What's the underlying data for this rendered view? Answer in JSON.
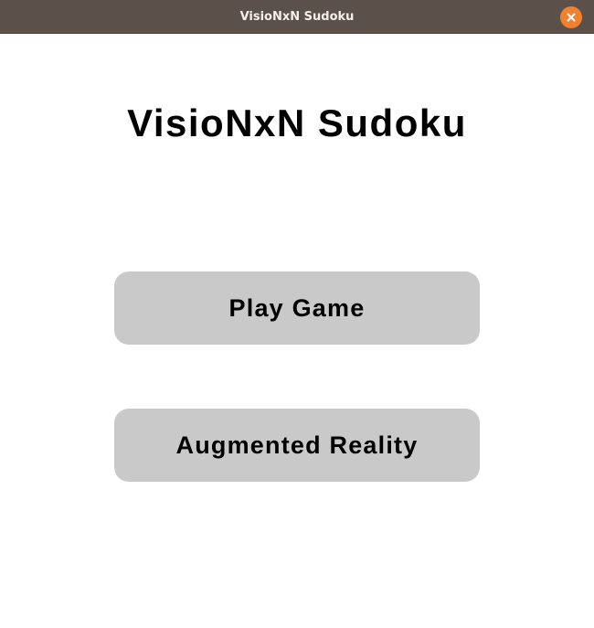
{
  "window": {
    "title": "VisioNxN Sudoku",
    "titlebar_color": "#5b514a",
    "close_button_color": "#f08131",
    "close_icon": "close-icon"
  },
  "main": {
    "heading": "VisioNxN Sudoku",
    "buttons": [
      {
        "label": "Play Game"
      },
      {
        "label": "Augmented Reality"
      }
    ],
    "button_color": "#c9c9c9"
  }
}
